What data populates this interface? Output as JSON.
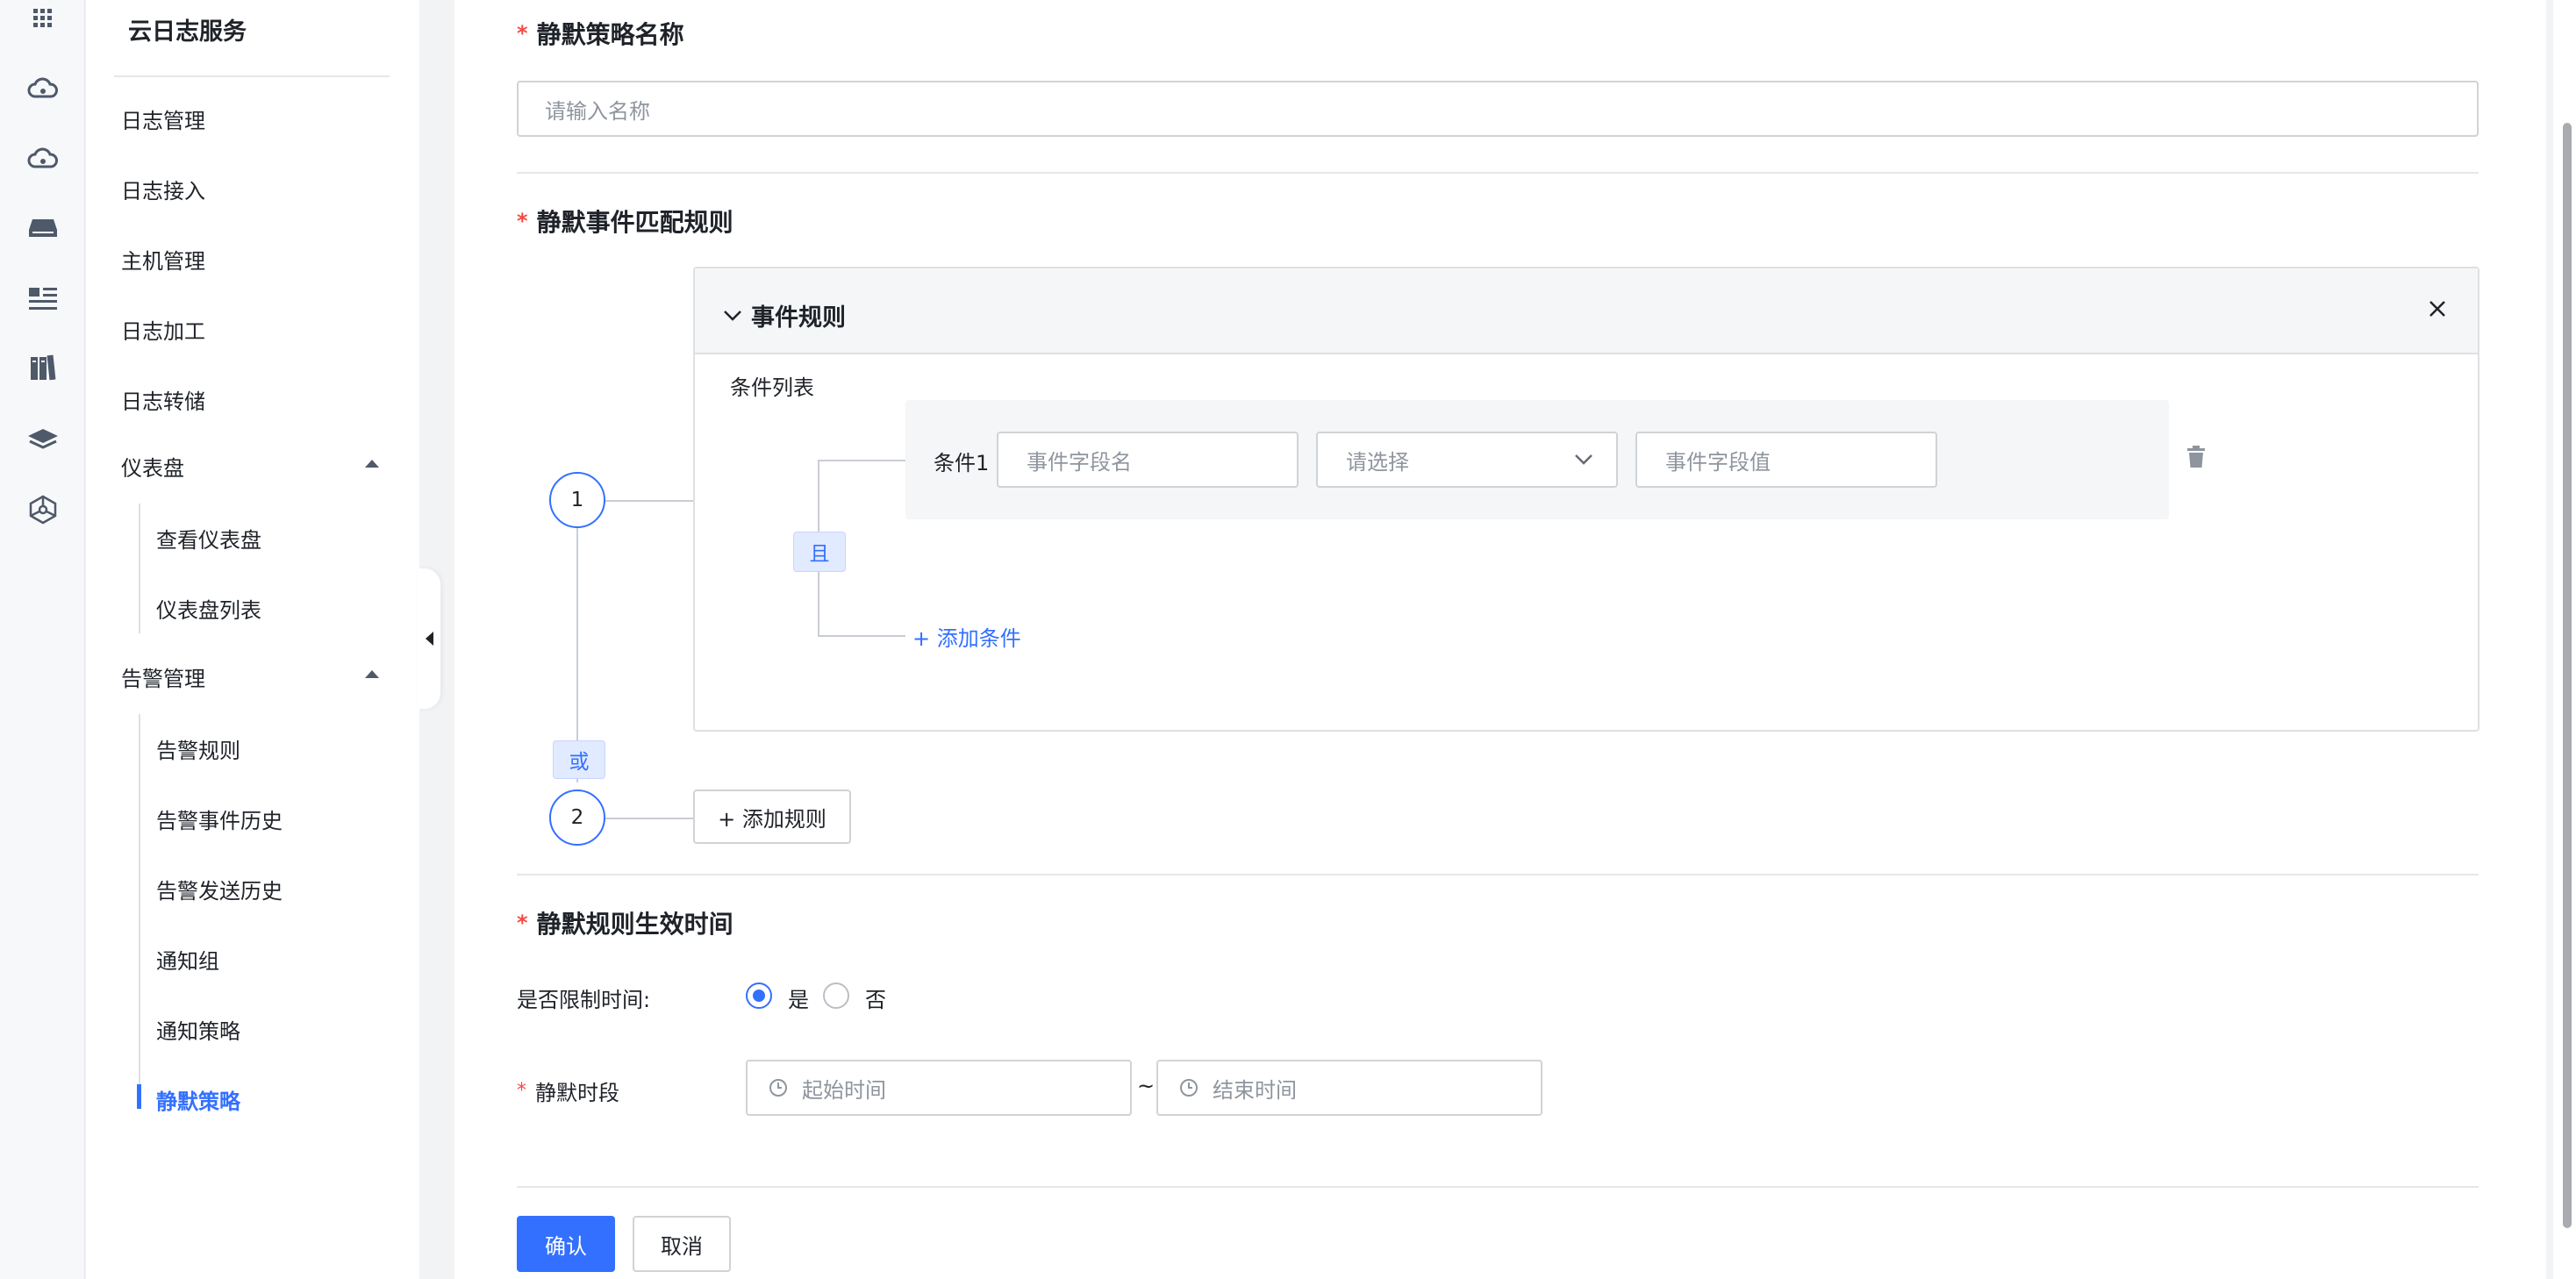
{
  "sidebar": {
    "title": "云日志服务",
    "items": [
      {
        "label": "日志管理"
      },
      {
        "label": "日志接入"
      },
      {
        "label": "主机管理"
      },
      {
        "label": "日志加工"
      },
      {
        "label": "日志转储"
      },
      {
        "label": "仪表盘"
      },
      {
        "label": "告警管理"
      }
    ],
    "dashboard_sub": [
      "查看仪表盘",
      "仪表盘列表"
    ],
    "alert_sub": [
      "告警规则",
      "告警事件历史",
      "告警发送历史",
      "通知组",
      "通知策略",
      "静默策略"
    ]
  },
  "form": {
    "name_section": {
      "title": "静默策略名称",
      "placeholder": "请输入名称"
    },
    "match_section": {
      "title": "静默事件匹配规则",
      "rule_title": "事件规则",
      "condition_list_label": "条件列表",
      "condition_label": "条件1",
      "field_name_placeholder": "事件字段名",
      "operator_placeholder": "请选择",
      "field_value_placeholder": "事件字段值",
      "and_label": "且",
      "add_condition": "+ 添加条件",
      "or_label": "或",
      "step1": "1",
      "step2": "2",
      "add_rule": "+ 添加规则"
    },
    "time_section": {
      "title": "静默规则生效时间",
      "limit_label": "是否限制时间:",
      "yes": "是",
      "no": "否",
      "period_label": "静默时段",
      "start_placeholder": "起始时间",
      "end_placeholder": "结束时间",
      "tilde": "~"
    },
    "confirm": "确认",
    "cancel": "取消"
  },
  "colors": {
    "accent": "#3370ff",
    "required": "#f54a45"
  }
}
